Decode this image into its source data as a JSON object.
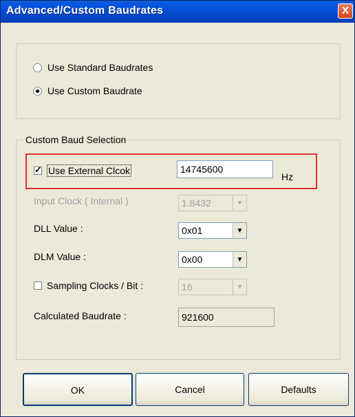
{
  "window": {
    "title": "Advanced/Custom Baudrates",
    "close_glyph": "X"
  },
  "baud_mode": {
    "options": [
      {
        "label": "Use Standard Baudrates",
        "checked": false
      },
      {
        "label": "Use Custom Baudrate",
        "checked": true
      }
    ]
  },
  "custom": {
    "legend": "Custom Baud Selection",
    "external_clock": {
      "label": "Use External Clcok",
      "checked": true,
      "value": "14745600",
      "unit": "Hz"
    },
    "input_clock": {
      "label": "Input Clock ( Internal )",
      "value": "1.8432",
      "enabled": false
    },
    "dll": {
      "label": "DLL Value :",
      "value": "0x01"
    },
    "dlm": {
      "label": "DLM Value :",
      "value": "0x00"
    },
    "sampling": {
      "label": "Sampling Clocks / Bit :",
      "checked": false,
      "value": "16",
      "enabled": false
    },
    "calculated": {
      "label": "Calculated Baudrate :",
      "value": "921600"
    }
  },
  "buttons": {
    "ok": "OK",
    "cancel": "Cancel",
    "defaults": "Defaults"
  },
  "colors": {
    "titlebar": "#0349cf",
    "dialog_bg": "#ece9d8",
    "highlight": "#e03030"
  }
}
